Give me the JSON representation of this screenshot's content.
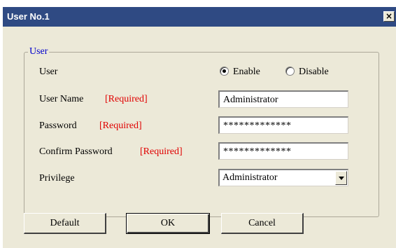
{
  "window": {
    "title": "User No.1",
    "close_glyph": "×",
    "close_icon": "close-icon"
  },
  "group": {
    "legend": "User"
  },
  "form": {
    "user_label": "User",
    "enable_label": "Enable",
    "enable_checked": true,
    "disable_label": "Disable",
    "disable_checked": false,
    "username_label": "User Name",
    "username_required": "[Required]",
    "username_value": "Administrator",
    "password_label": "Password",
    "password_required": "[Required]",
    "password_value": "*************",
    "confirm_label": "Confirm Password",
    "confirm_required": "[Required]",
    "confirm_value": "*************",
    "privilege_label": "Privilege",
    "privilege_value": "Administrator",
    "required_color": "#e00000",
    "legend_color": "#0000cc"
  },
  "buttons": {
    "default_label": "Default",
    "ok_label": "OK",
    "cancel_label": "Cancel"
  }
}
